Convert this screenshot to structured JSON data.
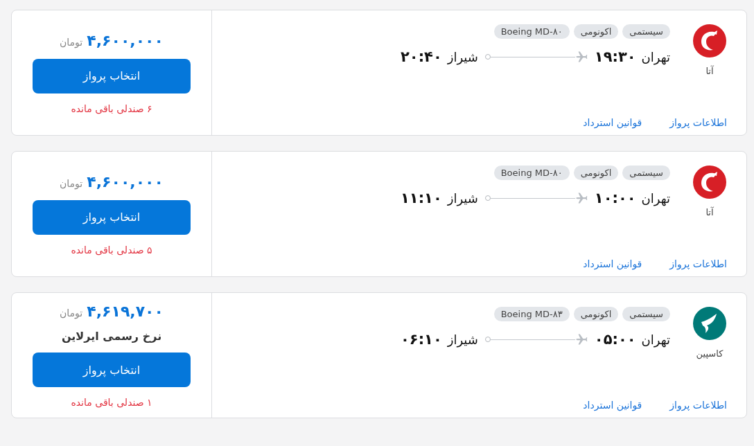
{
  "flights": [
    {
      "airline": {
        "name": "آتا",
        "color": "#d71f26"
      },
      "tags": [
        "سیستمی",
        "اکونومی",
        "Boeing MD-۸۰"
      ],
      "departure": {
        "city": "تهران",
        "time": "۱۹:۳۰"
      },
      "arrival": {
        "city": "شیراز",
        "time": "۲۰:۴۰"
      },
      "links": [
        "اطلاعات پرواز",
        "قوانین استرداد"
      ],
      "price": "۴,۶۰۰,۰۰۰",
      "currency": "تومان",
      "button": "انتخاب پرواز",
      "seats_left": "۶ صندلی باقی مانده"
    },
    {
      "airline": {
        "name": "آتا",
        "color": "#d71f26"
      },
      "tags": [
        "سیستمی",
        "اکونومی",
        "Boeing MD-۸۰"
      ],
      "departure": {
        "city": "تهران",
        "time": "۱۰:۰۰"
      },
      "arrival": {
        "city": "شیراز",
        "time": "۱۱:۱۰"
      },
      "links": [
        "اطلاعات پرواز",
        "قوانین استرداد"
      ],
      "price": "۴,۶۰۰,۰۰۰",
      "currency": "تومان",
      "button": "انتخاب پرواز",
      "seats_left": "۵ صندلی باقی مانده"
    },
    {
      "airline": {
        "name": "کاسپین",
        "color": "#007a78"
      },
      "tags": [
        "سیستمی",
        "اکونومی",
        "Boeing MD-۸۳"
      ],
      "departure": {
        "city": "تهران",
        "time": "۰۵:۰۰"
      },
      "arrival": {
        "city": "شیراز",
        "time": "۰۶:۱۰"
      },
      "links": [
        "اطلاعات پرواز",
        "قوانین استرداد"
      ],
      "price": "۴,۶۱۹,۷۰۰",
      "currency": "تومان",
      "fare_note": "نرخ رسمی ایرلاین",
      "button": "انتخاب پرواز",
      "seats_left": "۱ صندلی باقی مانده"
    }
  ]
}
